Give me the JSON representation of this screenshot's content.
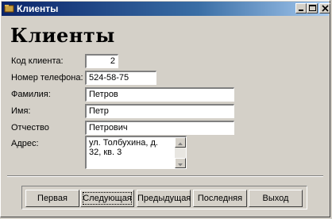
{
  "window": {
    "title": "Клиенты",
    "controls": [
      "minimize-icon",
      "maximize-icon",
      "close-icon"
    ]
  },
  "form": {
    "heading": "Клиенты",
    "fields": {
      "client_code": {
        "label": "Код клиента:",
        "value": "2"
      },
      "phone": {
        "label": "Номер телефона:",
        "value": "524-58-75"
      },
      "last_name": {
        "label": "Фамилия:",
        "value": "Петров"
      },
      "first_name": {
        "label": "Имя:",
        "value": "Петр"
      },
      "patronymic": {
        "label": "Отчество",
        "value": "Петрович"
      },
      "address": {
        "label": "Адрес:",
        "value": "ул. Толбухина, д. 32, кв. 3"
      }
    }
  },
  "navigation": {
    "first": "Первая",
    "next": "Следующая",
    "prev": "Предыдущая",
    "last": "Последняя",
    "exit": "Выход"
  },
  "colors": {
    "face": "#d4d0c8",
    "title_start": "#0a246a",
    "title_end": "#a6caf0"
  }
}
